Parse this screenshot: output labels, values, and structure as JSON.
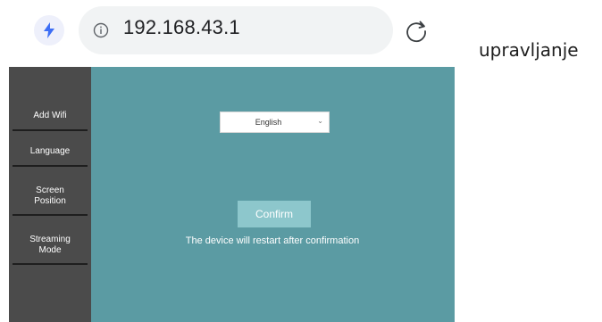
{
  "browser": {
    "url": "192.168.43.1",
    "icons": [
      "bolt-icon",
      "info-icon",
      "reload-icon"
    ],
    "accent": "#3d6ef5"
  },
  "side_text": "upravljanje",
  "sidebar": {
    "items": [
      {
        "line1": "Add Wifi",
        "line2": ""
      },
      {
        "line1": "Language",
        "line2": ""
      },
      {
        "line1": "Screen",
        "line2": "Position"
      },
      {
        "line1": "Streaming",
        "line2": "Mode"
      }
    ]
  },
  "main": {
    "language_select": {
      "value": "English"
    },
    "confirm_label": "Confirm",
    "restart_note": "The device will restart after confirmation"
  },
  "colors": {
    "page_background": "#5b9ba3",
    "sidebar_background": "#4b4b4b",
    "confirm_button": "#8dc7cc"
  }
}
